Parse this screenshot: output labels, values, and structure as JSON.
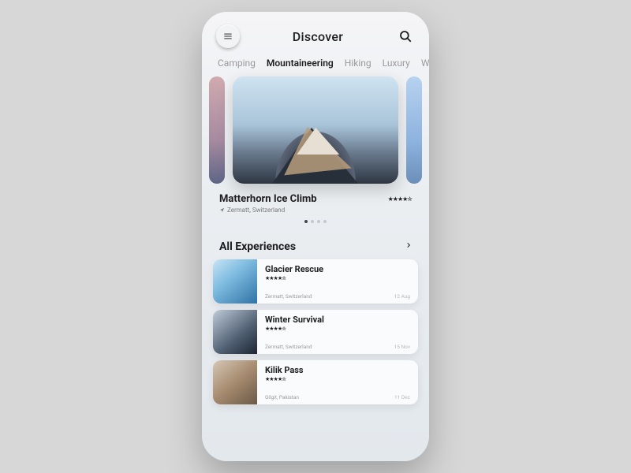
{
  "header": {
    "title": "Discover"
  },
  "tabs": [
    "Camping",
    "Mountaineering",
    "Hiking",
    "Luxury",
    "W"
  ],
  "activeTab": 1,
  "hero": {
    "title": "Matterhorn Ice Climb",
    "location": "Zermatt, Switzerland",
    "stars": "★★★★✮"
  },
  "pageDots": {
    "count": 4,
    "active": 0
  },
  "section": {
    "title": "All Experiences"
  },
  "experiences": [
    {
      "title": "Glacier Rescue",
      "stars": "★★★★✮",
      "location": "Zermatt, Switzerland",
      "date": "12 Aug"
    },
    {
      "title": "Winter Survival",
      "stars": "★★★★✮",
      "location": "Zermatt, Switzerland",
      "date": "15 Nov"
    },
    {
      "title": "Kilik Pass",
      "stars": "★★★★✮",
      "location": "Gilgit, Pakistan",
      "date": "11 Dec"
    }
  ]
}
